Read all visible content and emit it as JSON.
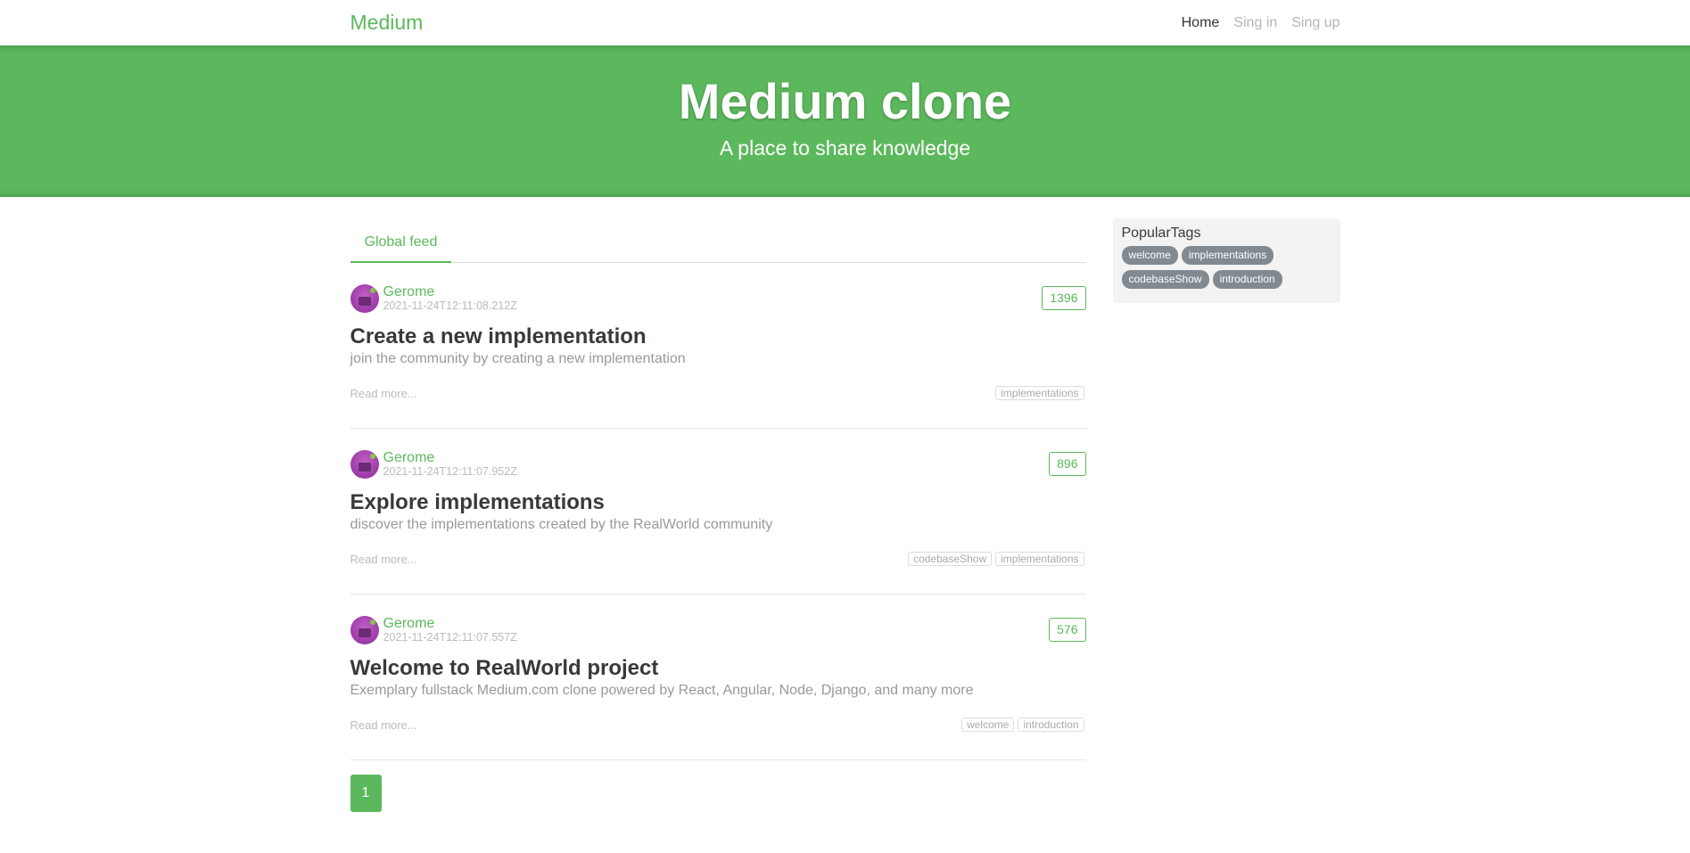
{
  "navbar": {
    "brand": "Medium",
    "links": [
      "Home",
      "Sing in",
      "Sing up"
    ]
  },
  "banner": {
    "title": "Medium clone",
    "subtitle": "A place to share knowledge"
  },
  "feed": {
    "tab": "Global feed",
    "articles": [
      {
        "author": "Gerome",
        "date": "2021-11-24T12:11:08.212Z",
        "likes": "1396",
        "title": "Create a new implementation",
        "description": "join the community by creating a new implementation",
        "read_more": "Read more...",
        "tags": [
          "implementations"
        ]
      },
      {
        "author": "Gerome",
        "date": "2021-11-24T12:11:07.952Z",
        "likes": "896",
        "title": "Explore implementations",
        "description": "discover the implementations created by the RealWorld community",
        "read_more": "Read more...",
        "tags": [
          "codebaseShow",
          "implementations"
        ]
      },
      {
        "author": "Gerome",
        "date": "2021-11-24T12:11:07.557Z",
        "likes": "576",
        "title": "Welcome to RealWorld project",
        "description": "Exemplary fullstack Medium.com clone powered by React, Angular, Node, Django, and many more",
        "read_more": "Read more...",
        "tags": [
          "welcome",
          "introduction"
        ]
      }
    ],
    "pagination": [
      "1"
    ]
  },
  "sidebar": {
    "heading": "PopularTags",
    "tags": [
      "welcome",
      "implementations",
      "codebaseShow",
      "introduction"
    ]
  },
  "colors": {
    "accent": "#5cb85c",
    "tag_pill": "#818a91"
  }
}
